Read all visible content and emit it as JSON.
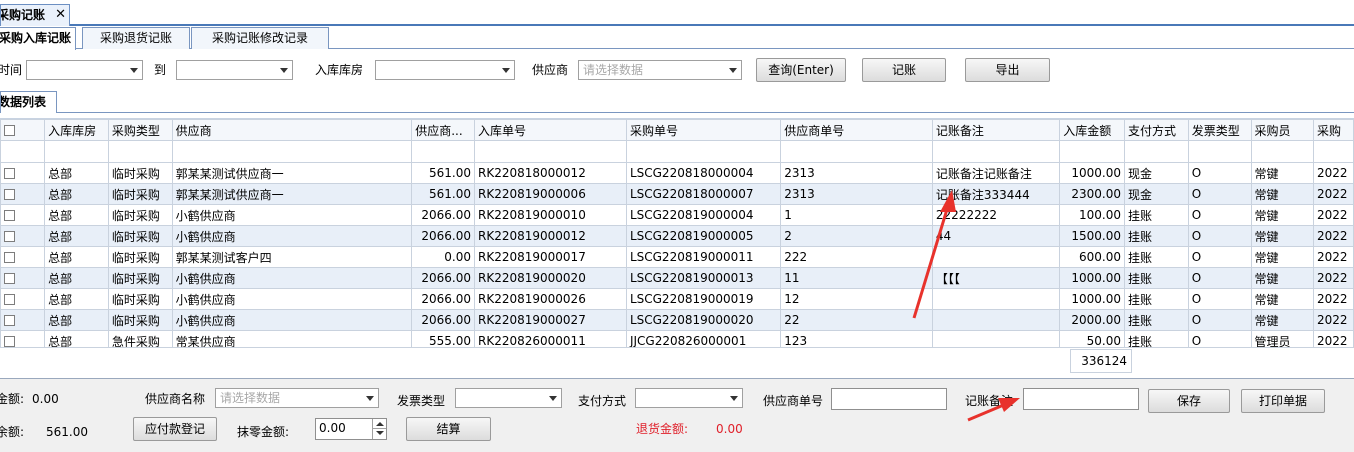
{
  "window": {
    "tab_title": "采购记账",
    "close_glyph": "✕"
  },
  "subtabs": [
    "采购入库记账",
    "采购退货记账",
    "采购记账修改记录"
  ],
  "filters": {
    "time_label": "时间",
    "to_label": "到",
    "warehouse_label": "入库库房",
    "supplier_label": "供应商",
    "supplier_placeholder": "请选择数据",
    "query_button": "查询(Enter)",
    "post_button": "记账",
    "export_button": "导出"
  },
  "list_tab": "数据列表",
  "grid": {
    "columns": [
      "",
      "入库库房",
      "采购类型",
      "供应商",
      "供应商...",
      "入库单号",
      "采购单号",
      "供应商单号",
      "记账备注",
      "入库金额",
      "支付方式",
      "发票类型",
      "采购员",
      "采购"
    ],
    "rows": [
      [
        "总部",
        "临时采购",
        "郭某某测试供应商一",
        "561.00",
        "RK220818000012",
        "LSCG220818000004",
        "2313",
        "记账备注记账备注",
        "1000.00",
        "现金",
        "O",
        "常键",
        "2022"
      ],
      [
        "总部",
        "临时采购",
        "郭某某测试供应商一",
        "561.00",
        "RK220819000006",
        "LSCG220818000007",
        "2313",
        "记账备注333444",
        "2300.00",
        "现金",
        "O",
        "常键",
        "2022"
      ],
      [
        "总部",
        "临时采购",
        "小鹤供应商",
        "2066.00",
        "RK220819000010",
        "LSCG220819000004",
        "1",
        "22222222",
        "100.00",
        "挂账",
        "O",
        "常键",
        "2022"
      ],
      [
        "总部",
        "临时采购",
        "小鹤供应商",
        "2066.00",
        "RK220819000012",
        "LSCG220819000005",
        "2",
        "44",
        "1500.00",
        "挂账",
        "O",
        "常键",
        "2022"
      ],
      [
        "总部",
        "临时采购",
        "郭某某测试客户四",
        "0.00",
        "RK220819000017",
        "LSCG220819000011",
        "222",
        "",
        "600.00",
        "挂账",
        "O",
        "常键",
        "2022"
      ],
      [
        "总部",
        "临时采购",
        "小鹤供应商",
        "2066.00",
        "RK220819000020",
        "LSCG220819000013",
        "11",
        "【【【",
        "1000.00",
        "挂账",
        "O",
        "常键",
        "2022"
      ],
      [
        "总部",
        "临时采购",
        "小鹤供应商",
        "2066.00",
        "RK220819000026",
        "LSCG220819000019",
        "12",
        "",
        "1000.00",
        "挂账",
        "O",
        "常键",
        "2022"
      ],
      [
        "总部",
        "临时采购",
        "小鹤供应商",
        "2066.00",
        "RK220819000027",
        "LSCG220819000020",
        "22",
        "",
        "2000.00",
        "挂账",
        "O",
        "常键",
        "2022"
      ],
      [
        "总部",
        "急件采购",
        "常某供应商",
        "555.00",
        "RK220826000011",
        "JJCG220826000001",
        "123",
        "",
        "50.00",
        "挂账",
        "O",
        "管理员",
        "2022"
      ]
    ],
    "total_amount": "336124"
  },
  "bottom": {
    "amount_label": "金额:",
    "amount_value": "0.00",
    "balance_label": "余额:",
    "balance_value": "561.00",
    "supplier_name_label": "供应商名称",
    "supplier_name_placeholder": "请选择数据",
    "invoice_type_label": "发票类型",
    "payment_label": "支付方式",
    "supplier_no_label": "供应商单号",
    "remark_label": "记账备注",
    "save_button": "保存",
    "print_button": "打印单据",
    "payable_button": "应付款登记",
    "rounding_label": "抹零金额:",
    "rounding_value": "0.00",
    "settle_button": "结算",
    "refund_label": "退货金额:",
    "refund_value": "0.00"
  },
  "colors": {
    "annotation": "#e8322c",
    "row_alt": "#e8eff8",
    "tab_border": "#4a79b8"
  }
}
